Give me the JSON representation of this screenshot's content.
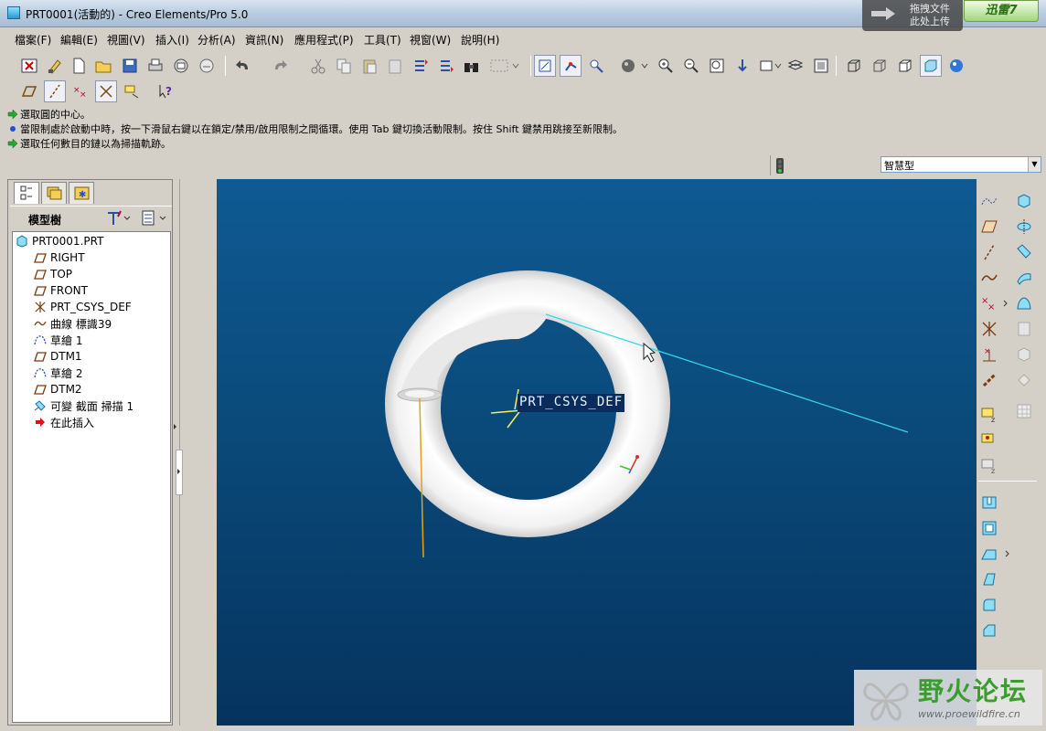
{
  "window": {
    "title": "PRT0001(活動的) - Creo Elements/Pro 5.0"
  },
  "overlay": {
    "drag_line1": "拖拽文件",
    "drag_line2": "此处上传",
    "xunlei_label": "迅雷7"
  },
  "menubar": {
    "items": [
      "檔案(F)",
      "編輯(E)",
      "視圖(V)",
      "插入(I)",
      "分析(A)",
      "資訊(N)",
      "應用程式(P)",
      "工具(T)",
      "視窗(W)",
      "說明(H)"
    ]
  },
  "messages": [
    {
      "icon": "green-arrow-icon",
      "text": "選取圓的中心。"
    },
    {
      "icon": "blue-bullet-icon",
      "text": "當限制處於啟動中時，按一下滑鼠右鍵以在鎖定/禁用/啟用限制之間循環。使用 Tab 鍵切換活動限制。按住 Shift 鍵禁用跳接至新限制。"
    },
    {
      "icon": "green-arrow-icon",
      "text": "選取任何數目的鏈以為掃描軌跡。"
    }
  ],
  "filter": {
    "selected": "智慧型"
  },
  "model_tree": {
    "title": "模型樹",
    "items": [
      {
        "icon": "part-icon",
        "label": "PRT0001.PRT"
      },
      {
        "icon": "datum-plane-icon",
        "label": "RIGHT"
      },
      {
        "icon": "datum-plane-icon",
        "label": "TOP"
      },
      {
        "icon": "datum-plane-icon",
        "label": "FRONT"
      },
      {
        "icon": "csys-icon",
        "label": "PRT_CSYS_DEF"
      },
      {
        "icon": "curve-icon",
        "label": "曲線 標識39"
      },
      {
        "icon": "sketch-icon",
        "label": "草繪 1"
      },
      {
        "icon": "datum-plane-icon",
        "label": "DTM1"
      },
      {
        "icon": "sketch-icon",
        "label": "草繪 2"
      },
      {
        "icon": "datum-plane-icon",
        "label": "DTM2"
      },
      {
        "icon": "variable-section-sweep-icon",
        "label": "可變 截面 掃描 1"
      },
      {
        "icon": "insert-here-arrow-icon",
        "label": "在此插入"
      }
    ]
  },
  "viewport": {
    "csys_label": "PRT_CSYS_DEF",
    "background_top": "#0f5a93",
    "background_bottom": "#06335e",
    "model_color": "#ffffff",
    "curve_color": "#34d7e6"
  },
  "watermark": {
    "text": "野火论坛",
    "url": "www.proewildfire.cn"
  },
  "colors": {
    "accent_green": "#3a9d2d",
    "selection_highlight": "#0a2c5c"
  }
}
